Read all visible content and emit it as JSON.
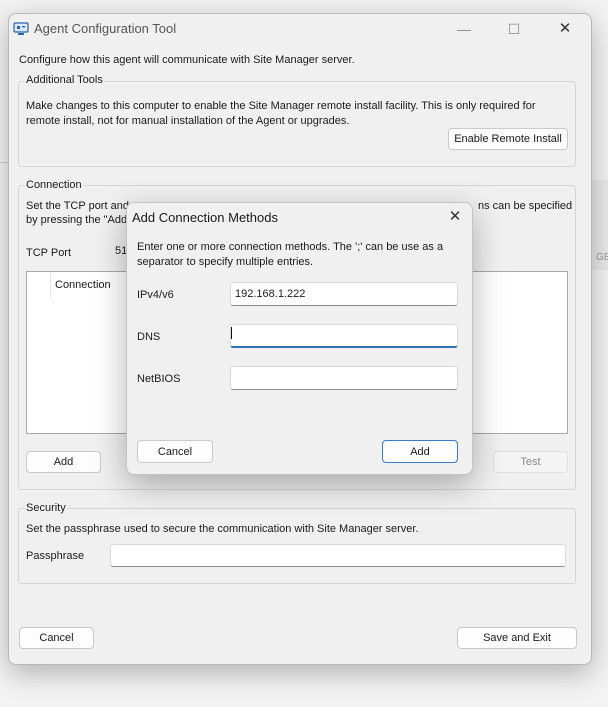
{
  "window": {
    "title": "Agent Configuration Tool",
    "controls": {
      "minimize": "—",
      "maximize": "☐",
      "close": "✕"
    },
    "intro_text": "Configure how this agent will communicate with Site Manager server."
  },
  "additional_tools": {
    "legend": "Additional Tools",
    "description_line1": "Make changes to this computer to enable the Site Manager remote install facility. This is only required for",
    "description_line2": "remote install, not for manual installation of the Agent or upgrades.",
    "enable_button": "Enable Remote Install"
  },
  "connection": {
    "legend": "Connection",
    "description_line1_left": "Set the TCP port and",
    "description_line1_right": "ns can be specified",
    "description_line2": "by pressing the \"Add",
    "tcp_port_label": "TCP Port",
    "tcp_port_value": "51",
    "list_header": "Connection",
    "add_button": "Add",
    "test_button": "Test"
  },
  "security": {
    "legend": "Security",
    "description": "Set the passphrase used to secure the communication with Site Manager server.",
    "passphrase_label": "Passphrase",
    "passphrase_value": ""
  },
  "footer": {
    "cancel_button": "Cancel",
    "save_button": "Save and Exit"
  },
  "dialog": {
    "title": "Add Connection Methods",
    "close": "✕",
    "instructions_line1": "Enter one or more connection methods. The ';' can be use as a",
    "instructions_line2": "separator to specify multiple entries.",
    "ipv4_label": "IPv4/v6",
    "ipv4_value": "192.168.1.222",
    "dns_label": "DNS",
    "dns_value": "",
    "netbios_label": "NetBIOS",
    "netbios_value": "",
    "cancel_button": "Cancel",
    "add_button": "Add"
  },
  "background": {
    "edge_text": "GE"
  },
  "colors": {
    "accent": "#2f6fb6",
    "window_bg": "#f0f0f0"
  },
  "icons": {
    "app": "agent-config-icon"
  }
}
